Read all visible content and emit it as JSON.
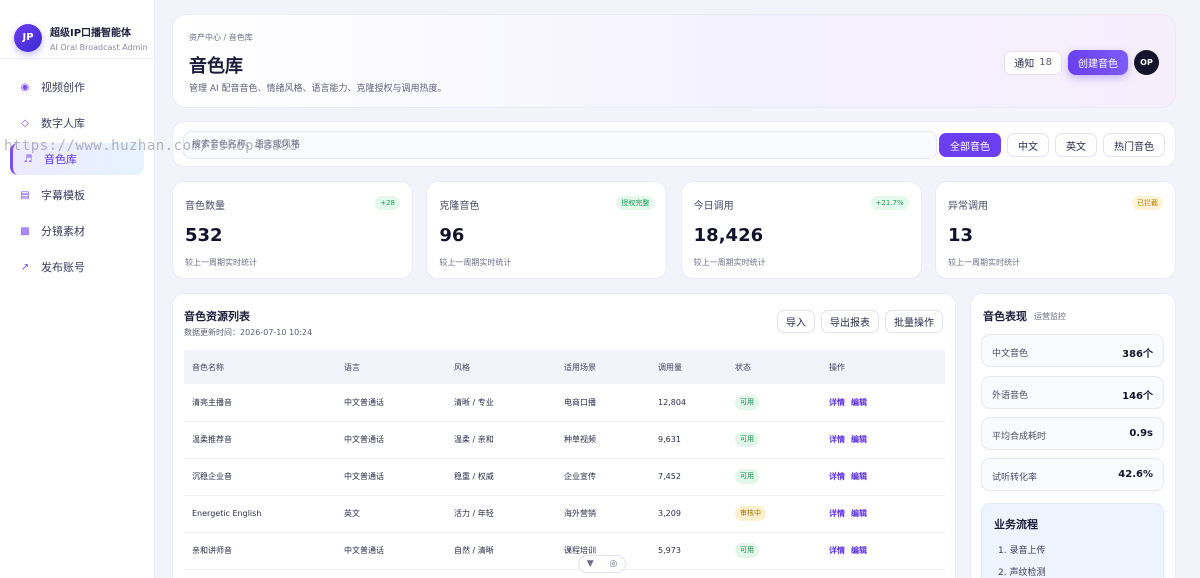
{
  "brand": {
    "logo": "JP",
    "title": "超级IP口播智能体",
    "subtitle": "AI Oral Broadcast Admin"
  },
  "sidebar": {
    "items": [
      {
        "icon": "◉",
        "label": "视频创作"
      },
      {
        "icon": "◇",
        "label": "数字人库"
      },
      {
        "icon": "♬",
        "label": "音色库"
      },
      {
        "icon": "▤",
        "label": "字幕模板"
      },
      {
        "icon": "▩",
        "label": "分镜素材"
      },
      {
        "icon": "↗",
        "label": "发布账号"
      }
    ]
  },
  "header": {
    "breadcrumb": "资产中心 / 音色库",
    "title": "音色库",
    "description": "管理 AI 配音音色、情绪风格、语言能力、克隆授权与调用热度。",
    "notify_label": "通知",
    "notify_count": "18",
    "create_label": "创建音色",
    "avatar": "OP"
  },
  "filter": {
    "search_text": "搜索音色名称、语言或风格",
    "chips": [
      "全部音色",
      "中文",
      "英文",
      "热门音色"
    ]
  },
  "stats": [
    {
      "label": "音色数量",
      "badge": "+28",
      "value": "532",
      "note": "较上一周期实时统计"
    },
    {
      "label": "克隆音色",
      "badge": "授权完整",
      "value": "96",
      "note": "较上一周期实时统计"
    },
    {
      "label": "今日调用",
      "badge": "+21.7%",
      "value": "18,426",
      "note": "较上一周期实时统计"
    },
    {
      "label": "异常调用",
      "badge": "已拦截",
      "value": "13",
      "note": "较上一周期实时统计"
    }
  ],
  "table": {
    "title": "音色资源列表",
    "updated": "数据更新时间：2026-07-10 10:24",
    "actions": [
      "导入",
      "导出报表",
      "批量操作"
    ],
    "columns": [
      "音色名称",
      "语言",
      "风格",
      "适用场景",
      "调用量",
      "状态",
      "操作"
    ],
    "detail_label": "详情",
    "edit_label": "编辑",
    "rows": [
      {
        "name": "清亮主播音",
        "lang": "中文普通话",
        "style": "清晰 / 专业",
        "scene": "电商口播",
        "calls": "12,804",
        "status": "可用"
      },
      {
        "name": "温柔推荐音",
        "lang": "中文普通话",
        "style": "温柔 / 亲和",
        "scene": "种草视频",
        "calls": "9,631",
        "status": "可用"
      },
      {
        "name": "沉稳企业音",
        "lang": "中文普通话",
        "style": "稳重 / 权威",
        "scene": "企业宣传",
        "calls": "7,452",
        "status": "可用"
      },
      {
        "name": "Energetic English",
        "lang": "英文",
        "style": "活力 / 年轻",
        "scene": "海外营销",
        "calls": "3,209",
        "status": "审核中"
      },
      {
        "name": "亲和讲师音",
        "lang": "中文普通话",
        "style": "自然 / 清晰",
        "scene": "课程培训",
        "calls": "5,973",
        "status": "可用"
      }
    ]
  },
  "performance": {
    "title": "音色表现",
    "tag": "运营监控",
    "metrics": [
      {
        "label": "中文音色",
        "value": "386个"
      },
      {
        "label": "外语音色",
        "value": "146个"
      },
      {
        "label": "平均合成耗时",
        "value": "0.9s"
      },
      {
        "label": "试听转化率",
        "value": "42.6%"
      }
    ],
    "flow_title": "业务流程",
    "flow_steps": [
      "1. 录音上传",
      "2. 声纹检测"
    ]
  },
  "watermark": "https://www.huzhan.com/ishop48893",
  "colors": {
    "accent": "#6b3ff0",
    "ok": "#168a4c",
    "review": "#a06e00"
  }
}
